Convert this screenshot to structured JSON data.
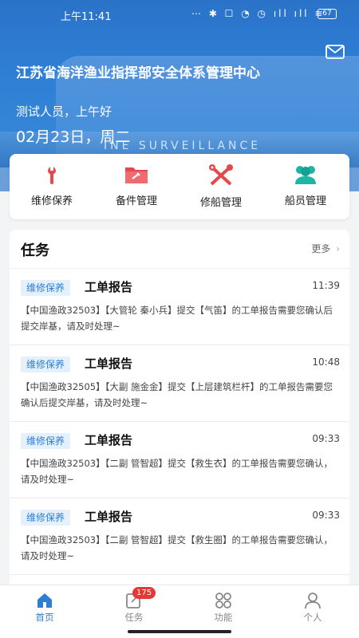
{
  "status_bar": {
    "time": "上午11:41",
    "icons_text": "⋯ ✱ ☐ ◔ ◷ ıll ıll ≋",
    "battery": "67"
  },
  "header": {
    "title": "江苏省海洋渔业指挥部安全体系管理中心",
    "greeting": "测试人员，上午好",
    "date": "02月23日，周二",
    "ship_text": "INE SURVEILLANCE"
  },
  "quick_actions": [
    {
      "label": "维修保养",
      "icon": "wrench-icon",
      "color": "#e5484d"
    },
    {
      "label": "备件管理",
      "icon": "folder-wrench-icon",
      "color": "#e5484d"
    },
    {
      "label": "修船管理",
      "icon": "tools-icon",
      "color": "#e5484d"
    },
    {
      "label": "船员管理",
      "icon": "crew-icon",
      "color": "#1fb5a3"
    }
  ],
  "tasks": {
    "title": "任务",
    "more": "更多",
    "items": [
      {
        "tag": "维修保养",
        "title": "工单报告",
        "time": "11:39",
        "body": "【中国渔政32503】【大管轮 秦小兵】提交【气笛】的工单报告需要您确认后提交岸基，请及时处理~"
      },
      {
        "tag": "维修保养",
        "title": "工单报告",
        "time": "10:48",
        "body": "【中国渔政32505】【大副 施金金】提交【上层建筑栏杆】的工单报告需要您确认后提交岸基，请及时处理~"
      },
      {
        "tag": "维修保养",
        "title": "工单报告",
        "time": "09:33",
        "body": "【中国渔政32503】【二副 管智超】提交【救生衣】的工单报告需要您确认，请及时处理~"
      },
      {
        "tag": "维修保养",
        "title": "工单报告",
        "time": "09:33",
        "body": "【中国渔政32503】【二副 管智超】提交【救生圈】的工单报告需要您确认，请及时处理~"
      }
    ]
  },
  "tabbar": {
    "items": [
      {
        "label": "首页",
        "icon": "home-icon",
        "active": true
      },
      {
        "label": "任务",
        "icon": "task-icon",
        "active": false
      },
      {
        "label": "功能",
        "icon": "grid-icon",
        "active": false
      },
      {
        "label": "个人",
        "icon": "person-icon",
        "active": false
      }
    ],
    "badge": "175"
  },
  "colors": {
    "primary": "#2e7fd3",
    "accent_red": "#e5484d",
    "accent_teal": "#1fb5a3",
    "badge": "#e53935"
  }
}
